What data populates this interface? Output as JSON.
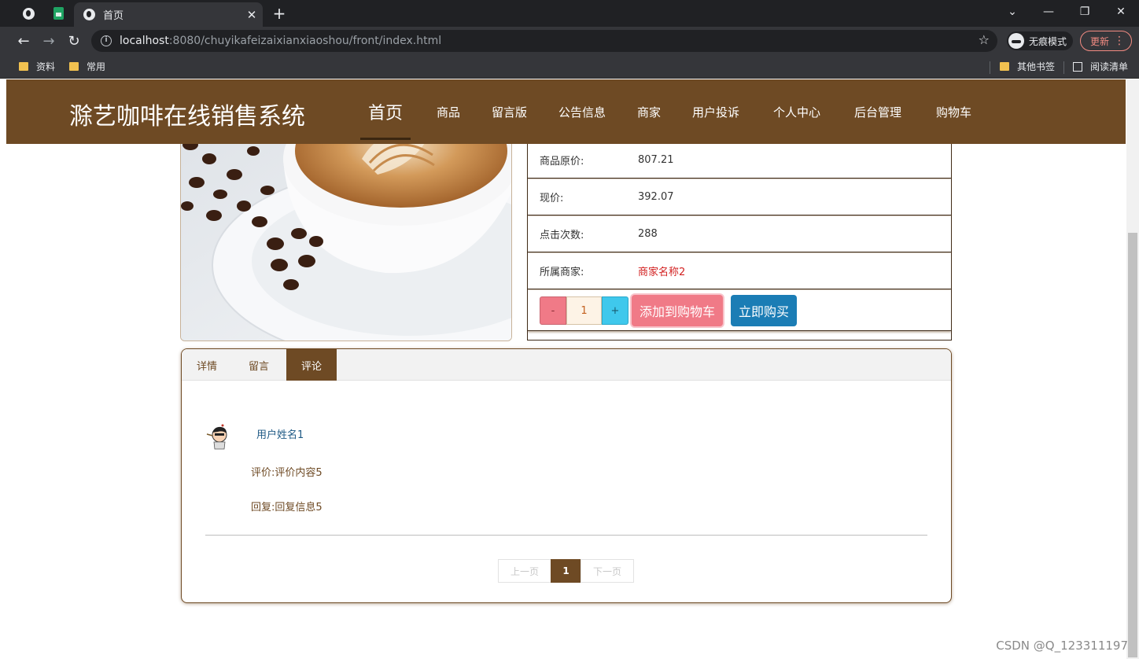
{
  "browser": {
    "tab_title": "首页",
    "url_host": "localhost",
    "url_rest": ":8080/chuyikafeizaixianxiaoshou/front/index.html",
    "incognito_label": "无痕模式",
    "update_label": "更新",
    "bookmarks": [
      "资料",
      "常用"
    ],
    "other_bookmarks": "其他书签",
    "reading_list": "阅读清单"
  },
  "site": {
    "brand": "滁艺咖啡在线销售系统",
    "nav": [
      "首页",
      "商品",
      "留言版",
      "公告信息",
      "商家",
      "用户投诉",
      "个人中心",
      "后台管理",
      "购物车"
    ]
  },
  "product": {
    "original_price_label": "商品原价:",
    "original_price": "807.21",
    "current_price_label": "现价:",
    "current_price": "392.07",
    "clicks_label": "点击次数:",
    "clicks": "288",
    "merchant_label": "所属商家:",
    "merchant": "商家名称2",
    "qty_minus": "-",
    "qty": "1",
    "qty_plus": "+",
    "add_to_cart": "添加到购物车",
    "buy_now": "立即购买"
  },
  "panel": {
    "tabs": [
      "详情",
      "留言",
      "评论"
    ],
    "active_tab": "评论",
    "comment": {
      "user": "用户姓名1",
      "review": "评价:评价内容5",
      "reply": "回复:回复信息5"
    },
    "pager": {
      "prev": "上一页",
      "current": "1",
      "next": "下一页"
    }
  },
  "watermark": "CSDN @Q_123311197",
  "colors": {
    "brand_brown": "#6e4a24",
    "cart_pink": "#f07a87",
    "buy_blue": "#1b7db5",
    "plus_cyan": "#3fc8ec",
    "merchant_red": "#d22020"
  }
}
